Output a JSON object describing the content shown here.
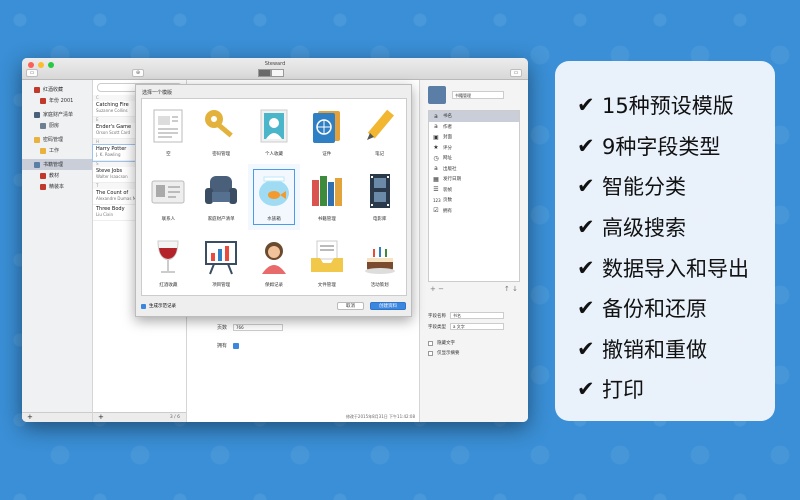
{
  "window": {
    "title": "Steward"
  },
  "sidebar": {
    "items": [
      {
        "label": "红酒收藏",
        "sub": false,
        "color": "#c0392b"
      },
      {
        "label": "年份 2001",
        "sub": true,
        "color": "#c0392b"
      },
      {
        "label": "家庭财产清单",
        "sub": false,
        "color": "#4a5f7a"
      },
      {
        "label": "厨房",
        "sub": true,
        "color": "#6e7f8f"
      },
      {
        "label": "密码管理",
        "sub": false,
        "color": "#e8b23c"
      },
      {
        "label": "工作",
        "sub": true,
        "color": "#e8b23c"
      },
      {
        "label": "书籍管理",
        "sub": false,
        "color": "#5b7ea6",
        "selected": true
      },
      {
        "label": "教材",
        "sub": true,
        "color": "#c0392b"
      },
      {
        "label": "精装本",
        "sub": true,
        "color": "#c0392b"
      }
    ],
    "add_label": "+"
  },
  "book_list": {
    "groups": [
      {
        "letter": "C",
        "books": [
          {
            "title": "Catching Fire",
            "author": "Suzanne Collins"
          }
        ]
      },
      {
        "letter": "E",
        "books": [
          {
            "title": "Ender's Game",
            "author": "Orson Scott Card"
          }
        ]
      },
      {
        "letter": "H",
        "books": [
          {
            "title": "Harry Potter",
            "author": "J. K. Rowling",
            "selected": true
          }
        ]
      },
      {
        "letter": "S",
        "books": [
          {
            "title": "Steve Jobs",
            "author": "Walter Isaacson"
          }
        ]
      },
      {
        "letter": "T",
        "books": [
          {
            "title": "The Count of",
            "author": "Alexandre Dumas Maque"
          },
          {
            "title": "Three Body",
            "author": "Liu Cixin"
          }
        ]
      }
    ],
    "add_label": "+",
    "count": "3 / 6"
  },
  "detail": {
    "pages_label": "页数",
    "pages_value": "766",
    "owned_label": "拥有",
    "status": "修改于2015年8月31日 下午11:42:08"
  },
  "fields_panel": {
    "collection_name": "书籍管理",
    "fields": [
      {
        "icon": "a",
        "label": "书名",
        "selected": true
      },
      {
        "icon": "a",
        "label": "作者"
      },
      {
        "icon": "▣",
        "label": "封面"
      },
      {
        "icon": "★",
        "label": "评分"
      },
      {
        "icon": "◷",
        "label": "网址"
      },
      {
        "icon": "a",
        "label": "出版社"
      },
      {
        "icon": "▦",
        "label": "发行日期"
      },
      {
        "icon": "☰",
        "label": "装帧"
      },
      {
        "icon": "123",
        "label": "页数"
      },
      {
        "icon": "☑",
        "label": "拥有"
      }
    ],
    "field_name_label": "字段名称",
    "field_name_value": "书名",
    "field_type_label": "字段类型",
    "field_type_value": "文字",
    "option_hide_text": "隐藏文字",
    "option_show_summary": "仅显示摘要"
  },
  "sheet": {
    "title": "选择一个模版",
    "templates": [
      {
        "label": "空",
        "icon": "blank-document-icon"
      },
      {
        "label": "密码管理",
        "icon": "key-icon"
      },
      {
        "label": "个人收藏",
        "icon": "portrait-icon"
      },
      {
        "label": "证件",
        "icon": "id-card-icon"
      },
      {
        "label": "笔记",
        "icon": "pencil-icon"
      },
      {
        "label": "联系人",
        "icon": "contact-card-icon"
      },
      {
        "label": "家庭财产清单",
        "icon": "armchair-icon"
      },
      {
        "label": "水族箱",
        "icon": "fishbowl-icon",
        "selected": true
      },
      {
        "label": "书籍管理",
        "icon": "books-icon"
      },
      {
        "label": "电影库",
        "icon": "film-icon"
      },
      {
        "label": "红酒收藏",
        "icon": "wine-glass-icon"
      },
      {
        "label": "项目管理",
        "icon": "chart-board-icon"
      },
      {
        "label": "保姆记录",
        "icon": "nanny-icon"
      },
      {
        "label": "文件管理",
        "icon": "file-tray-icon"
      },
      {
        "label": "活动策划",
        "icon": "cake-icon"
      }
    ],
    "generate_examples_label": "生成示范记录",
    "cancel_label": "取消",
    "create_label": "创建资料"
  },
  "features": [
    "15种预设模版",
    "9种字段类型",
    "智能分类",
    "高级搜索",
    "数据导入和导出",
    "备份和还原",
    "撤销和重做",
    "打印"
  ],
  "checkmark": "✔",
  "colors": {
    "background": "#3a8fd6",
    "accent": "#3b87e0",
    "selection": "#c9ced8"
  }
}
